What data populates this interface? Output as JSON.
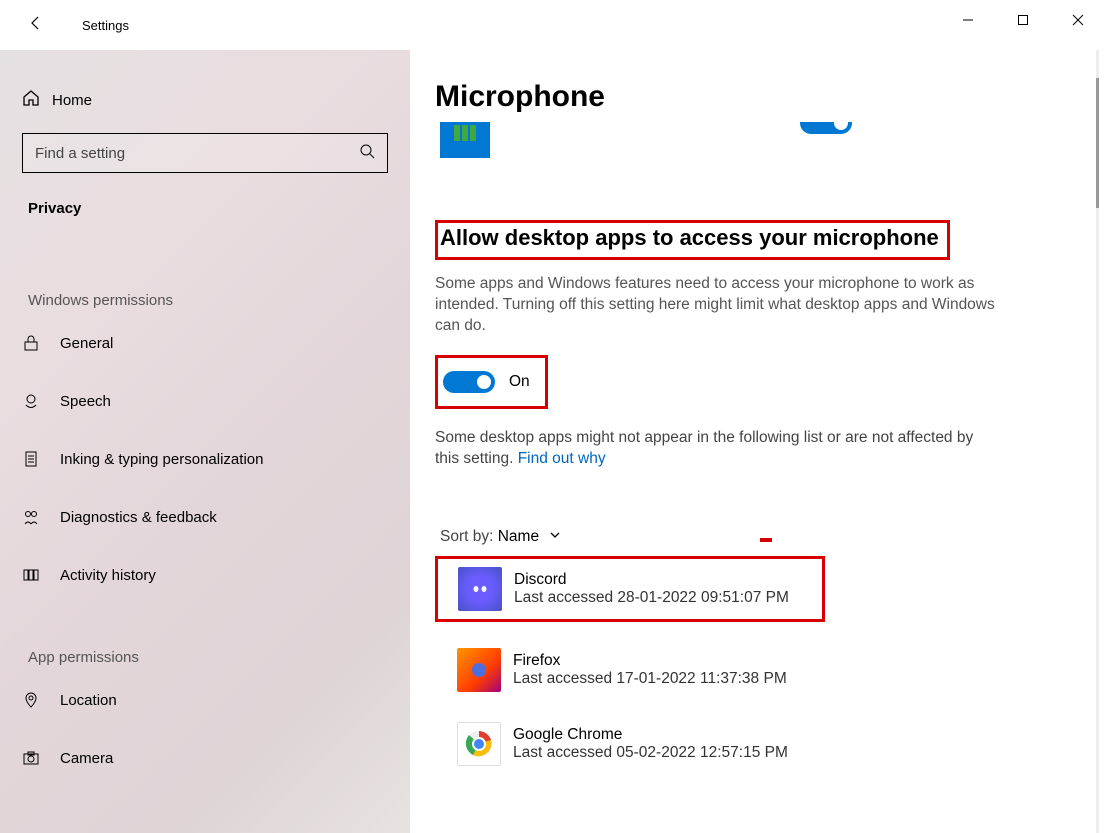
{
  "window": {
    "title": "Settings"
  },
  "sidebar": {
    "home_label": "Home",
    "search_placeholder": "Find a setting",
    "category": "Privacy",
    "groups": [
      {
        "heading": "Windows permissions",
        "items": [
          {
            "label": "General"
          },
          {
            "label": "Speech"
          },
          {
            "label": "Inking & typing personalization"
          },
          {
            "label": "Diagnostics & feedback"
          },
          {
            "label": "Activity history"
          }
        ]
      },
      {
        "heading": "App permissions",
        "items": [
          {
            "label": "Location"
          },
          {
            "label": "Camera"
          }
        ]
      }
    ]
  },
  "page": {
    "title": "Microphone",
    "section_heading": "Allow desktop apps to access your microphone",
    "section_desc": "Some apps and Windows features need to access your microphone to work as intended. Turning off this setting here might limit what desktop apps and Windows can do.",
    "toggle_state": "On",
    "note_prefix": "Some desktop apps might not appear in the following list or are not affected by this setting. ",
    "note_link": "Find out why",
    "sort_label": "Sort by:",
    "sort_value": "Name",
    "apps": [
      {
        "name": "Discord",
        "sub": "Last accessed 28-01-2022 09:51:07 PM"
      },
      {
        "name": "Firefox",
        "sub": "Last accessed 17-01-2022 11:37:38 PM"
      },
      {
        "name": "Google Chrome",
        "sub": "Last accessed 05-02-2022 12:57:15 PM"
      }
    ]
  }
}
